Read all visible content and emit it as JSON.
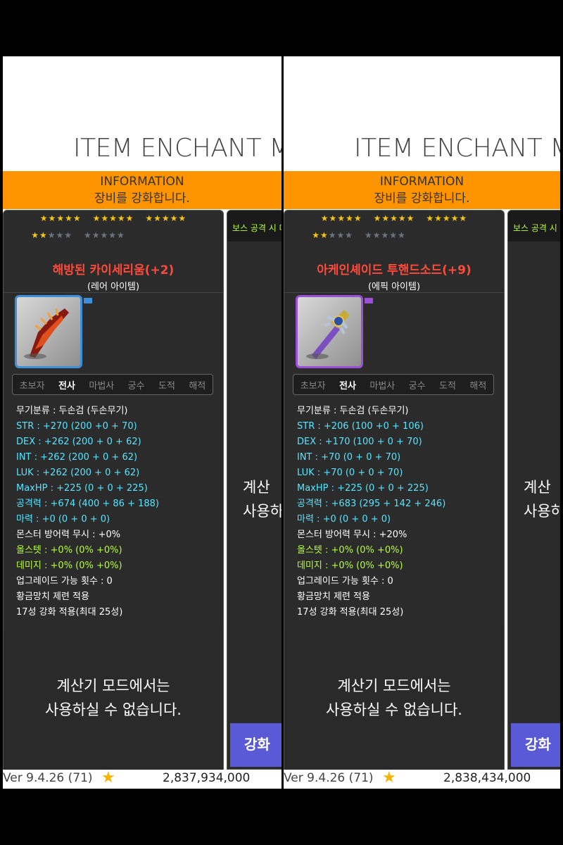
{
  "panels": [
    {
      "title": "ITEM ENCHANT M",
      "info": {
        "line1": "INFORMATION",
        "line2": "장비를 강화합니다."
      },
      "stars": {
        "earned": 2
      },
      "item": {
        "name": "해방된 카이세리움(+2)",
        "grade": "(레어 아이템)",
        "icon": "red-bow-weapon-icon",
        "border_color": "#3d8fd9"
      },
      "jobs": [
        "초보자",
        "전사",
        "마법사",
        "궁수",
        "도적",
        "해적"
      ],
      "active_job": "전사",
      "stats": [
        {
          "text": "무기분류 : 두손검 (두손무기)",
          "color": "white"
        },
        {
          "text": "STR : +270 (200 +0 + 70)",
          "color": "cyan"
        },
        {
          "text": "DEX : +262 (200 + 0 + 62)",
          "color": "cyan"
        },
        {
          "text": "INT : +262 (200 + 0 + 62)",
          "color": "cyan"
        },
        {
          "text": "LUK : +262 (200 + 0 + 62)",
          "color": "cyan"
        },
        {
          "text": "MaxHP : +225 (0 + 0 + 225)",
          "color": "cyan"
        },
        {
          "text": "공격력 : +674 (400 + 86 + 188)",
          "color": "cyan"
        },
        {
          "text": "마력 : +0 (0 + 0 + 0)",
          "color": "cyan"
        },
        {
          "text": "몬스터 방어력 무시 : +0%",
          "color": "white"
        },
        {
          "text": "올스텟 : +0% (0% +0%)",
          "color": "green"
        },
        {
          "text": "데미지 : +0% (0% +0%)",
          "color": "green"
        },
        {
          "text": "업그레이드 가능 횟수 : 0",
          "color": "white"
        },
        {
          "text": "황금망치 제련 적용",
          "color": "white"
        },
        {
          "text": "17성 강화 적용(최대 25성)",
          "color": "white"
        }
      ],
      "calc_msg": {
        "line1": "계산기 모드에서는",
        "line2": "사용하실 수 없습니다."
      },
      "side": {
        "boss_text": "보스 공격 시 데",
        "calc_line1": "계산",
        "calc_line2": "사용하",
        "button": "강화"
      },
      "footer": {
        "version": "Ver 9.4.26 (71)",
        "money": "2,837,934,000"
      }
    },
    {
      "title": "ITEM ENCHANT M",
      "info": {
        "line1": "INFORMATION",
        "line2": "장비를 강화합니다."
      },
      "stars": {
        "earned": 2
      },
      "item": {
        "name": "아케인셰이드 투핸드소드(+9)",
        "grade": "(에픽 아이템)",
        "icon": "arcane-sword-weapon-icon",
        "border_color": "#9b4fd8"
      },
      "jobs": [
        "초보자",
        "전사",
        "마법사",
        "궁수",
        "도적",
        "해적"
      ],
      "active_job": "전사",
      "stats": [
        {
          "text": "무기분류 : 두손검 (두손무기)",
          "color": "white"
        },
        {
          "text": "STR : +206 (100 +0 + 106)",
          "color": "cyan"
        },
        {
          "text": "DEX : +170 (100 + 0 + 70)",
          "color": "cyan"
        },
        {
          "text": "INT : +70 (0 + 0 + 70)",
          "color": "cyan"
        },
        {
          "text": "LUK : +70 (0 + 0 + 70)",
          "color": "cyan"
        },
        {
          "text": "MaxHP : +225 (0 + 0 + 225)",
          "color": "cyan"
        },
        {
          "text": "공격력 : +683 (295 + 142 + 246)",
          "color": "cyan"
        },
        {
          "text": "마력 : +0 (0 + 0 + 0)",
          "color": "cyan"
        },
        {
          "text": "몬스터 방어력 무시 : +20%",
          "color": "white"
        },
        {
          "text": "올스텟 : +0% (0% +0%)",
          "color": "green"
        },
        {
          "text": "데미지 : +0% (0% +0%)",
          "color": "green"
        },
        {
          "text": "업그레이드 가능 횟수 : 0",
          "color": "white"
        },
        {
          "text": "황금망치 제련 적용",
          "color": "white"
        },
        {
          "text": "17성 강화 적용(최대 25성)",
          "color": "white"
        }
      ],
      "calc_msg": {
        "line1": "계산기 모드에서는",
        "line2": "사용하실 수 없습니다."
      },
      "side": {
        "boss_text": "보스 공격 시",
        "calc_line1": "계산",
        "calc_line2": "사용하",
        "button": "강화"
      },
      "footer": {
        "version": "Ver 9.4.26 (71)",
        "money": "2,838,434,000"
      }
    }
  ]
}
